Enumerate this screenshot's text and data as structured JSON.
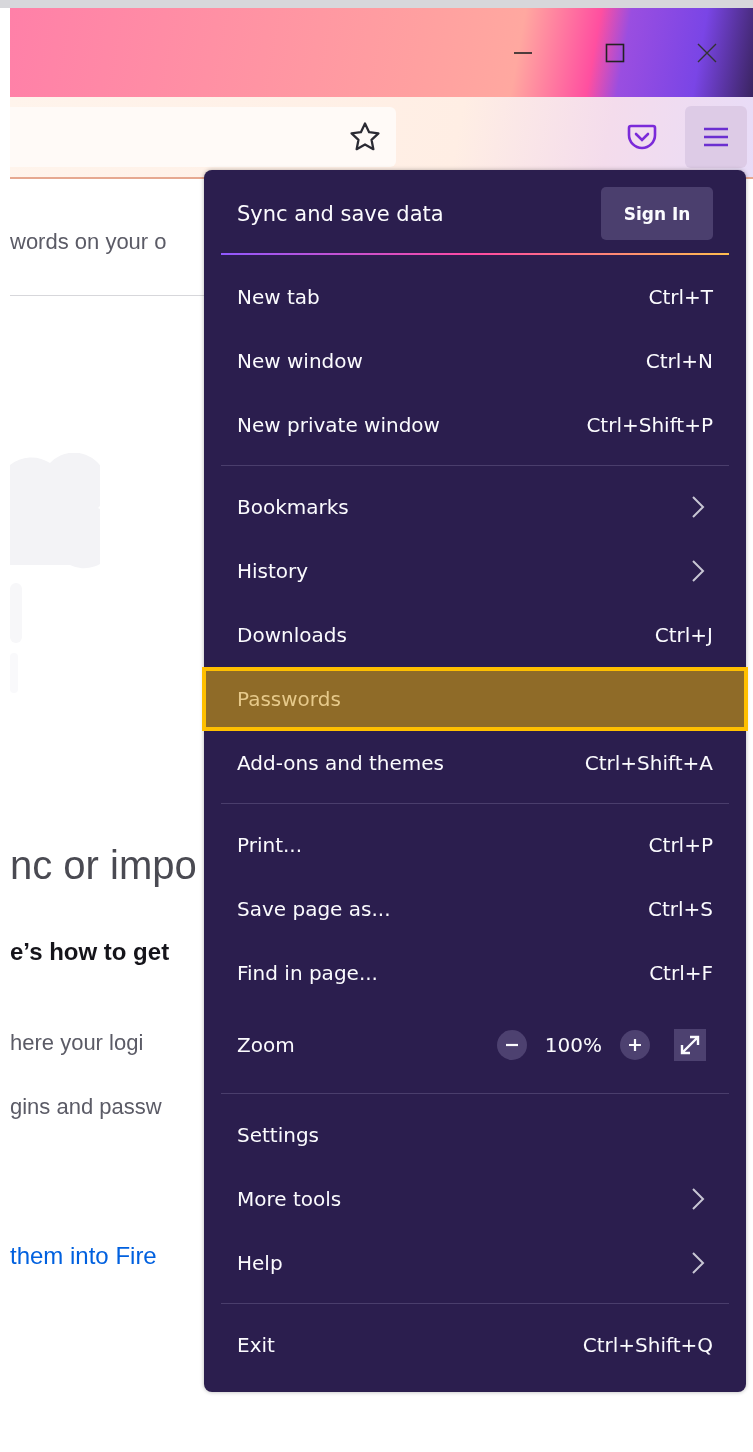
{
  "page": {
    "lines": [
      {
        "kind": "text",
        "text": "words on your o"
      },
      {
        "kind": "rule"
      },
      {
        "kind": "illustration"
      },
      {
        "kind": "heading",
        "text": "nc or impo"
      },
      {
        "kind": "strong",
        "text": "e’s how to get"
      },
      {
        "kind": "text",
        "text": "here your logi"
      },
      {
        "kind": "text",
        "text": "gins and passw"
      },
      {
        "kind": "link",
        "text": "them into Fire"
      }
    ]
  },
  "menu": {
    "header": {
      "title": "Sync and save data",
      "button": "Sign In"
    },
    "sections": [
      [
        {
          "kind": "item",
          "label": "New tab",
          "shortcut": "Ctrl+T",
          "selected": false
        },
        {
          "kind": "item",
          "label": "New window",
          "shortcut": "Ctrl+N",
          "selected": false
        },
        {
          "kind": "item",
          "label": "New private window",
          "shortcut": "Ctrl+Shift+P",
          "selected": false
        }
      ],
      [
        {
          "kind": "submenu",
          "label": "Bookmarks",
          "selected": false
        },
        {
          "kind": "submenu",
          "label": "History",
          "selected": false
        },
        {
          "kind": "item",
          "label": "Downloads",
          "shortcut": "Ctrl+J",
          "selected": false
        },
        {
          "kind": "item",
          "label": "Passwords",
          "selected": true
        },
        {
          "kind": "item",
          "label": "Add-ons and themes",
          "shortcut": "Ctrl+Shift+A",
          "selected": false
        }
      ],
      [
        {
          "kind": "item",
          "label": "Print...",
          "shortcut": "Ctrl+P",
          "selected": false
        },
        {
          "kind": "item",
          "label": "Save page as...",
          "shortcut": "Ctrl+S",
          "selected": false
        },
        {
          "kind": "item",
          "label": "Find in page...",
          "shortcut": "Ctrl+F",
          "selected": false
        },
        {
          "kind": "zoom",
          "label": "Zoom",
          "value": "100%"
        }
      ],
      [
        {
          "kind": "item",
          "label": "Settings",
          "selected": false
        },
        {
          "kind": "submenu",
          "label": "More tools",
          "selected": false
        },
        {
          "kind": "submenu",
          "label": "Help",
          "selected": false
        }
      ],
      [
        {
          "kind": "item",
          "label": "Exit",
          "shortcut": "Ctrl+Shift+Q",
          "selected": false
        }
      ]
    ]
  }
}
